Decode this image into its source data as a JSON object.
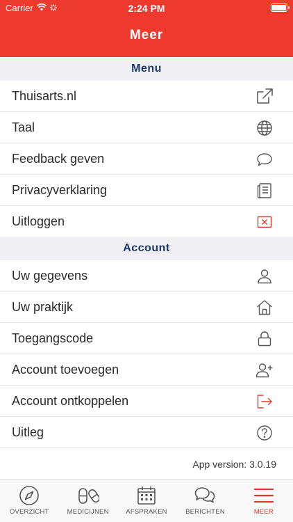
{
  "status_bar": {
    "carrier": "Carrier",
    "time": "2:24 PM"
  },
  "header": {
    "title": "Meer"
  },
  "sections": {
    "menu": {
      "title": "Menu",
      "items": [
        {
          "label": "Thuisarts.nl",
          "icon": "external-link-icon"
        },
        {
          "label": "Taal",
          "icon": "globe-icon"
        },
        {
          "label": "Feedback geven",
          "icon": "speech-bubble-icon"
        },
        {
          "label": "Privacyverklaring",
          "icon": "document-icon"
        },
        {
          "label": "Uitloggen",
          "icon": "logout-x-icon"
        }
      ]
    },
    "account": {
      "title": "Account",
      "items": [
        {
          "label": "Uw gegevens",
          "icon": "user-icon"
        },
        {
          "label": "Uw praktijk",
          "icon": "home-icon"
        },
        {
          "label": "Toegangscode",
          "icon": "lock-icon"
        },
        {
          "label": "Account toevoegen",
          "icon": "user-plus-icon"
        },
        {
          "label": "Account ontkoppelen",
          "icon": "logout-arrow-icon"
        },
        {
          "label": "Uitleg",
          "icon": "help-icon"
        }
      ]
    }
  },
  "app_version": "App version: 3.0.19",
  "tabbar": {
    "tabs": [
      {
        "label": "OVERZICHT",
        "icon": "compass-icon"
      },
      {
        "label": "MEDICIJNEN",
        "icon": "pills-icon"
      },
      {
        "label": "AFSPRAKEN",
        "icon": "calendar-icon"
      },
      {
        "label": "BERICHTEN",
        "icon": "chat-icon"
      },
      {
        "label": "MEER",
        "icon": "menu-icon"
      }
    ],
    "active_index": 4
  },
  "colors": {
    "brand": "#ee3a2e",
    "section_text": "#1b3a6b",
    "danger": "#d93a30"
  }
}
